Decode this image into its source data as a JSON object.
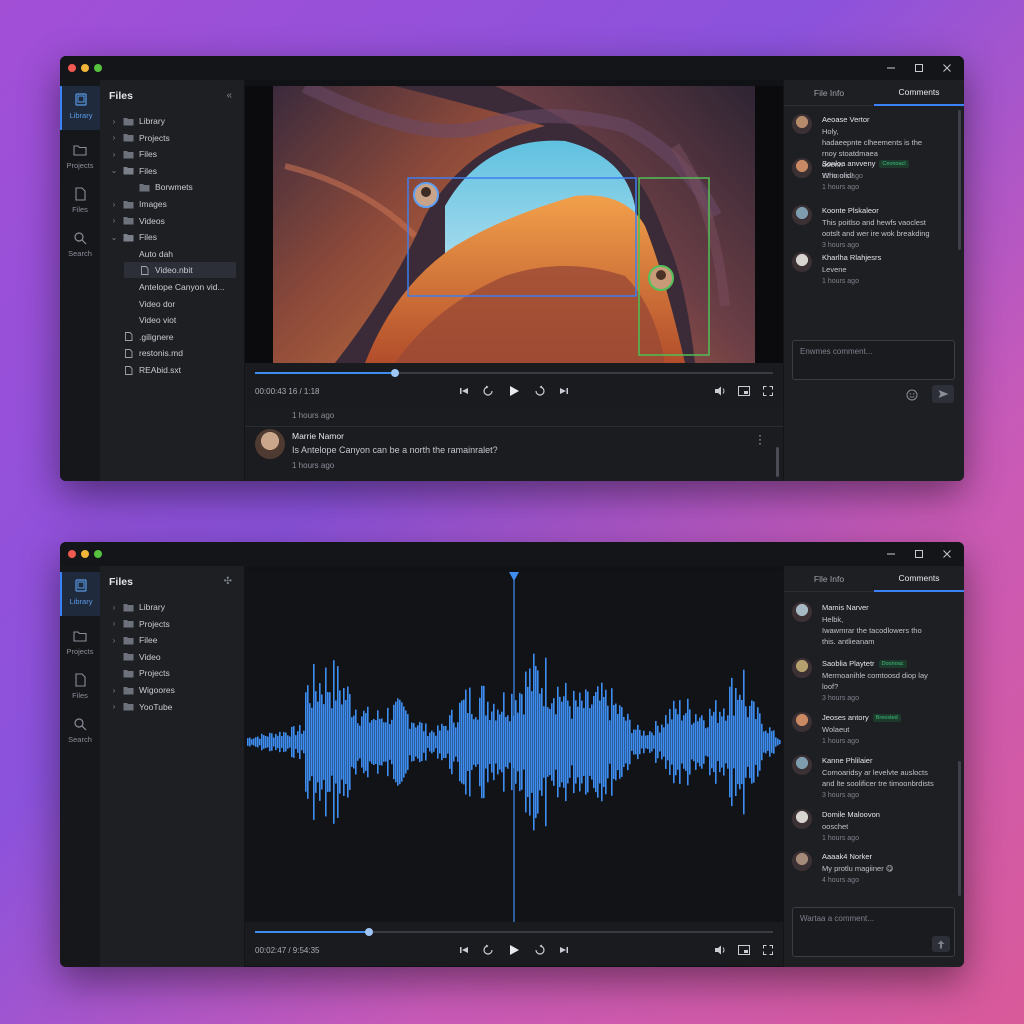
{
  "colors": {
    "accent": "#3b82f6",
    "waveform": "#3d8ef0",
    "badge": "#39c07a"
  },
  "windows": [
    {
      "id": "video-window",
      "sidebar": {
        "items": [
          {
            "label": "Library",
            "icon": "library-icon",
            "active": true
          },
          {
            "label": "Projects",
            "icon": "folder-icon"
          },
          {
            "label": "Files",
            "icon": "file-icon"
          },
          {
            "label": "Search",
            "icon": "search-icon"
          }
        ]
      },
      "tree": {
        "title": "Files",
        "items": [
          {
            "label": "Library",
            "type": "folder",
            "expand": "collapsed",
            "depth": 0
          },
          {
            "label": "Projects",
            "type": "folder",
            "expand": "collapsed",
            "depth": 0
          },
          {
            "label": "Files",
            "type": "folder",
            "expand": "collapsed",
            "depth": 0
          },
          {
            "label": "Files",
            "type": "folder",
            "expand": "expanded",
            "depth": 0
          },
          {
            "label": "Borwmets",
            "type": "folder",
            "expand": "none",
            "depth": 1
          },
          {
            "label": "Images",
            "type": "folder",
            "expand": "collapsed",
            "depth": 0
          },
          {
            "label": "Videos",
            "type": "folder",
            "expand": "collapsed",
            "depth": 0
          },
          {
            "label": "Files",
            "type": "folder",
            "expand": "expanded",
            "depth": 0
          },
          {
            "label": "Auto dah",
            "type": "none",
            "expand": "none",
            "depth": 1
          },
          {
            "label": "Video.nbit",
            "type": "file",
            "expand": "none",
            "depth": 1,
            "selected": true
          },
          {
            "label": "Antelope Canyon vid...",
            "type": "none",
            "expand": "none",
            "depth": 1
          },
          {
            "label": "Video dor",
            "type": "none",
            "expand": "none",
            "depth": 1
          },
          {
            "label": "Video viot",
            "type": "none",
            "expand": "none",
            "depth": 1
          },
          {
            "label": ".gilignere",
            "type": "file",
            "expand": "none",
            "depth": 0
          },
          {
            "label": "restonis.md",
            "type": "file",
            "expand": "none",
            "depth": 0
          },
          {
            "label": "REAbid.sxt",
            "type": "file",
            "expand": "none",
            "depth": 0
          }
        ]
      },
      "player": {
        "time": "00:00:43 16 / 1:18",
        "progress": 0.27
      },
      "strip": {
        "time_top": "1 hours ago",
        "name": "Marrie Namor",
        "text": "Is Antelope Canyon can be a north the ramainralet?",
        "time": "1 hours ago"
      },
      "panel": {
        "tabs": [
          "File Info",
          "Comments"
        ],
        "active_tab": 1,
        "comments": [
          {
            "name": "Aeoase Vertor",
            "lines": [
              "Holy,",
              "hadaeepnte clheements is the",
              "rnoy stoatdmaea",
              "doenn"
            ],
            "time": "12 hours ago",
            "avatar": "#b58a6a"
          },
          {
            "name": "Sonloa anvveny",
            "badge": "Ceonoacl",
            "lines": [
              "Who olid!"
            ],
            "time": "1 hours ago",
            "avatar": "#c98a63"
          },
          {
            "name": "Koonte Plskaleor",
            "lines": [
              "This poitlso and hewfs vaoclest",
              "ootslt and wer ire wok breakding"
            ],
            "time": "3 hours ago",
            "avatar": "#7e9eb0"
          },
          {
            "name": "Kharlha Rlahjesrs",
            "lines": [
              "Levene"
            ],
            "time": "1 hours ago",
            "avatar": "#d8d4cf"
          }
        ],
        "input_placeholder": "Enwmes comment..."
      }
    },
    {
      "id": "audio-window",
      "sidebar": {
        "items": [
          {
            "label": "Library",
            "icon": "library-icon",
            "active": true
          },
          {
            "label": "Projects",
            "icon": "folder-icon"
          },
          {
            "label": "Files",
            "icon": "file-icon"
          },
          {
            "label": "Search",
            "icon": "search-icon"
          }
        ]
      },
      "tree": {
        "title": "Files",
        "items": [
          {
            "label": "Library",
            "type": "folder",
            "expand": "collapsed",
            "depth": 0
          },
          {
            "label": "Projects",
            "type": "folder",
            "expand": "collapsed",
            "depth": 0
          },
          {
            "label": "Filee",
            "type": "folder",
            "expand": "collapsed",
            "depth": 0
          },
          {
            "label": "Video",
            "type": "folder",
            "expand": "none",
            "depth": 0
          },
          {
            "label": "Projects",
            "type": "folder",
            "expand": "none",
            "depth": 0
          },
          {
            "label": "Wigoores",
            "type": "folder",
            "expand": "collapsed",
            "depth": 0
          },
          {
            "label": "YooTube",
            "type": "folder",
            "expand": "collapsed",
            "depth": 0
          }
        ]
      },
      "player": {
        "time": "00:02:47 / 9:54:35",
        "progress": 0.22
      },
      "panel": {
        "tabs": [
          "Flle Info",
          "Comments"
        ],
        "active_tab": 1,
        "comments": [
          {
            "name": "Mamis Narver",
            "lines": [
              "Helbk,",
              "Iwawmrar the tacodlowers tho",
              "this. antlieanam"
            ],
            "time": "",
            "avatar": "#a7b9c4"
          },
          {
            "name": "Saoblia Playtetr",
            "badge": "Doonoac",
            "lines": [
              "Mermoanihle comtoosd diop lay",
              "loof?"
            ],
            "time": "3 hours ago",
            "avatar": "#b4a06e"
          },
          {
            "name": "Jeoses antory",
            "badge": "Breosted",
            "lines": [
              "Wolaeut"
            ],
            "time": "1 hours ago",
            "avatar": "#c98a63"
          },
          {
            "name": "Kanne Phlilaier",
            "lines": [
              "Comoaridsy ar levelvte auslocts",
              "and lte soolificer tre timoonbrdists"
            ],
            "time": "3 hours ago",
            "avatar": "#7e9eb0"
          },
          {
            "name": "Domile Maloovon",
            "lines": [
              "ooschet"
            ],
            "time": "1 hours ago",
            "avatar": "#d8d4cf"
          },
          {
            "name": "Aaaak4 Norker",
            "lines": [
              "My protlu magiiner 😋"
            ],
            "time": "4 hours ago",
            "avatar": "#a58a7a"
          }
        ],
        "input_placeholder": "Wartaa a comment..."
      }
    }
  ]
}
